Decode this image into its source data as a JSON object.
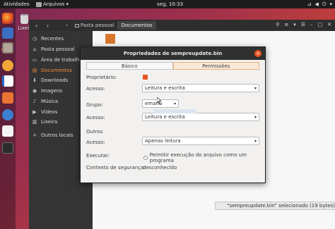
{
  "topbar": {
    "activities": "Atividades",
    "app_menu": "Arquivos",
    "app_menu_arrow": "▾",
    "clock": "seg, 10:33",
    "tray_network_icon": "⊿",
    "tray_volume_icon": "◀",
    "tray_power_icon": "⏻",
    "tray_arrow": "▾"
  },
  "dock": {
    "items": [
      "firefox",
      "thunderbird",
      "files",
      "rhythmbox",
      "writer",
      "software-center",
      "help",
      "amazon",
      "terminal"
    ]
  },
  "desktop": {
    "trash_label": "Lixeira"
  },
  "file_manager": {
    "nav_back": "‹",
    "nav_forward": "›",
    "path": {
      "prev_arrow": "‹",
      "home": "Pasta pessoal",
      "current": "Documentos"
    },
    "tools": {
      "search": "⚲",
      "view": "≡",
      "options": "▾",
      "menu": "☰",
      "minimize": "–",
      "maximize": "□",
      "close": "✕"
    },
    "sidebar": [
      {
        "icon": "◷",
        "label": "Recentes"
      },
      {
        "icon": "⌂",
        "label": "Pasta pessoal"
      },
      {
        "icon": "▭",
        "label": "Área de trabalh"
      },
      {
        "icon": "▤",
        "label": "Documentos"
      },
      {
        "icon": "⬇",
        "label": "Downloads"
      },
      {
        "icon": "◉",
        "label": "Imagens"
      },
      {
        "icon": "♪",
        "label": "Música"
      },
      {
        "icon": "▶",
        "label": "Vídeos"
      },
      {
        "icon": "▥",
        "label": "Lixeira"
      },
      {
        "icon": "+",
        "label": "Outros locais"
      }
    ],
    "status": "“sempreupdate.bin” selecionado  (19 bytes)"
  },
  "dialog": {
    "title": "Propriedades de sempreupdate.bin",
    "close_glyph": "×",
    "tabs": {
      "basic": "Básico",
      "permissions": "Permissões"
    },
    "owner": {
      "label": "Proprietário:",
      "access_label": "Acesso:",
      "access_value": "Leitura e escrita"
    },
    "group": {
      "label": "Grupo:",
      "value": "emanu",
      "access_label": "Acesso:",
      "access_value": "Leitura e escrita"
    },
    "others": {
      "label": "Outros",
      "access_label": "Acesso:",
      "access_value": "Apenas leitura"
    },
    "execute": {
      "label": "Executar:",
      "option": "Permitir execução do arquivo como um programa"
    },
    "security": {
      "label": "Contexto de segurança:",
      "value": "desconhecido"
    },
    "dropdown_arrow": "▾"
  },
  "colors": {
    "accent": "#e95420",
    "sidebar_active": "#f28b3b",
    "titlebar": "#303030"
  }
}
